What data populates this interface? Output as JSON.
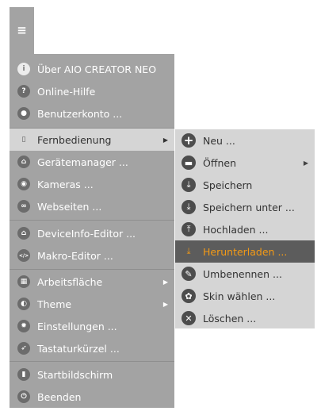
{
  "menu_button": {
    "icon": "hamburger-icon",
    "glyph": "≡"
  },
  "main_menu": {
    "items": [
      {
        "label": "Über AIO CREATOR NEO",
        "icon": "info-icon",
        "glyph": "i"
      },
      {
        "label": "Online-Hilfe",
        "icon": "question-icon",
        "glyph": "?"
      },
      {
        "label": "Benutzerkonto ...",
        "icon": "user-icon",
        "glyph": "●"
      },
      {
        "label": "Fernbedienung",
        "icon": "remote-icon",
        "glyph": "▯",
        "has_submenu": true,
        "highlighted": true
      },
      {
        "label": "Gerätemanager ...",
        "icon": "home-device-icon",
        "glyph": "⌂"
      },
      {
        "label": "Kameras ...",
        "icon": "webcam-icon",
        "glyph": "◉"
      },
      {
        "label": "Webseiten ...",
        "icon": "link-icon",
        "glyph": "∞"
      },
      {
        "label": "DeviceInfo-Editor ...",
        "icon": "home-device-icon",
        "glyph": "⌂"
      },
      {
        "label": "Makro-Editor ...",
        "icon": "code-icon",
        "glyph": "</>"
      },
      {
        "label": "Arbeitsfläche",
        "icon": "grid-icon",
        "glyph": "▦",
        "has_submenu": true
      },
      {
        "label": "Theme",
        "icon": "contrast-icon",
        "glyph": "◐",
        "has_submenu": true
      },
      {
        "label": "Einstellungen ...",
        "icon": "gear-icon",
        "glyph": "✹"
      },
      {
        "label": "Tastaturkürzel ...",
        "icon": "rocket-icon",
        "glyph": "➶"
      },
      {
        "label": "Startbildschirm",
        "icon": "door-icon",
        "glyph": "▮"
      },
      {
        "label": "Beenden",
        "icon": "power-icon",
        "glyph": "⏻"
      }
    ],
    "arrow_glyph": "▶"
  },
  "submenu": {
    "items": [
      {
        "label": "Neu ...",
        "icon": "plus-icon",
        "glyph": "+"
      },
      {
        "label": "Öffnen",
        "icon": "folder-icon",
        "glyph": "▬",
        "has_submenu": true
      },
      {
        "label": "Speichern",
        "icon": "save-icon",
        "glyph": "⤓"
      },
      {
        "label": "Speichern unter ...",
        "icon": "save-as-icon",
        "glyph": "⤓"
      },
      {
        "label": "Hochladen ...",
        "icon": "upload-icon",
        "glyph": "⤒"
      },
      {
        "label": "Herunterladen ...",
        "icon": "download-icon",
        "glyph": "⤓",
        "active": true
      },
      {
        "label": "Umbenennen ...",
        "icon": "pencil-icon",
        "glyph": "✎"
      },
      {
        "label": "Skin wählen ...",
        "icon": "palette-icon",
        "glyph": "✿"
      },
      {
        "label": "Löschen ...",
        "icon": "delete-icon",
        "glyph": "✕"
      }
    ],
    "arrow_glyph": "▶"
  },
  "colors": {
    "menu_bg": "#a3a3a3",
    "submenu_bg": "#d5d5d5",
    "active_bg": "#5c5c5c",
    "accent": "#f39a16"
  }
}
